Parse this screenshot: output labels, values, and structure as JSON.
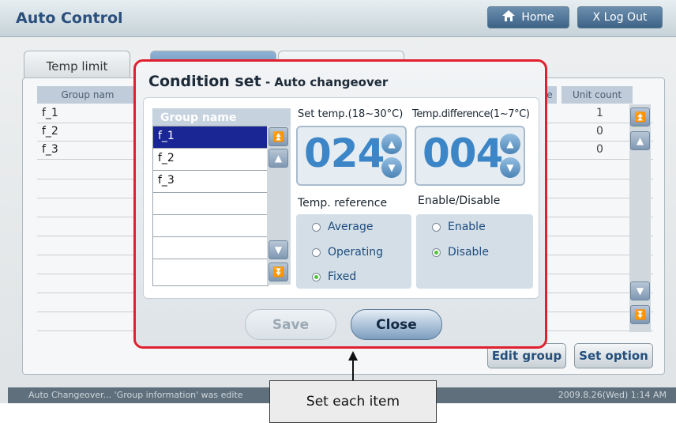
{
  "app": {
    "title": "Auto Control",
    "home_label": "Home",
    "logout_label": "X Log Out"
  },
  "tabs": [
    "Temp limit",
    "",
    ""
  ],
  "background_table": {
    "col_group_name": "Group nam",
    "col_partial": "e",
    "col_unit_count": "Unit count",
    "rows": [
      {
        "name": "f_1",
        "count": "1"
      },
      {
        "name": "f_2",
        "count": "0"
      },
      {
        "name": "f_3",
        "count": "0"
      }
    ]
  },
  "actions": {
    "edit_group": "Edit group",
    "set_option": "Set option"
  },
  "status": {
    "message": "Auto Changeover... 'Group information' was edite",
    "datetime": "2009.8.26(Wed)  1:14 AM"
  },
  "dialog": {
    "title": "Condition set",
    "subtitle": " - Auto changeover",
    "group_header": "Group name",
    "groups": [
      "f_1",
      "f_2",
      "f_3",
      "",
      "",
      "",
      ""
    ],
    "selected_group_index": 0,
    "set_temp_label": "Set temp.(18~30°C)",
    "set_temp_value": "024",
    "temp_diff_label": "Temp.difference(1~7°C)",
    "temp_diff_value": "004",
    "temp_ref_label": "Temp. reference",
    "temp_ref_options": [
      "Average",
      "Operating",
      "Fixed"
    ],
    "temp_ref_selected": "Fixed",
    "enable_label": "Enable/Disable",
    "enable_options": [
      "Enable",
      "Disable"
    ],
    "enable_selected": "Disable",
    "save_label": "Save",
    "close_label": "Close"
  },
  "callout": {
    "text": "Set each item"
  },
  "colors": {
    "accent": "#3c86c7",
    "highlight_border": "#e0202e",
    "selection": "#1a2694",
    "radio_on": "#52c23a"
  }
}
